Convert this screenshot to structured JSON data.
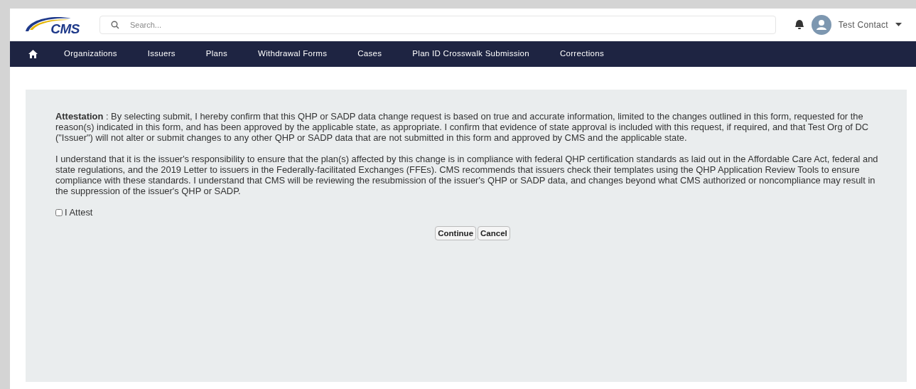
{
  "header": {
    "logo": "CMS",
    "search": {
      "placeholder": "Search..."
    },
    "user": "Test Contact"
  },
  "nav": {
    "items": [
      {
        "label": "Organizations"
      },
      {
        "label": "Issuers"
      },
      {
        "label": "Plans"
      },
      {
        "label": "Withdrawal Forms"
      },
      {
        "label": "Cases"
      },
      {
        "label": "Plan ID Crosswalk Submission"
      },
      {
        "label": "Corrections"
      }
    ]
  },
  "attestation": {
    "paragraphs": [
      "**Attestation** : By selecting submit, I hereby confirm that this QHP or SADP data change request is based on true and accurate information, limited to the changes outlined in this form, requested for the reason(s) indicated in this form, and has been approved by the applicable state, as appropriate. I confirm that evidence of state approval is included with this request, if required, and that Test Org of DC (\"Issuer\") will not alter or submit changes to any other QHP or SADP data that are not submitted in this form and approved by CMS and the applicable state.",
      "I understand that it is the issuer's responsibility to ensure that the plan(s) affected by this change is in compliance with federal QHP certification standards as laid out in the Affordable Care Act, federal and state regulations, and the 2019 Letter to issuers in the Federally-facilitated Exchanges (FFEs). CMS recommends that issuers check their templates using the QHP Application Review Tools to ensure compliance with these standards. I understand that CMS will be reviewing the resubmission of the issuer's QHP or SADP data, and changes beyond what CMS authorized or noncompliance may result in the suppression of the issuer's QHP or SADP."
    ],
    "checkbox": {
      "label": "I Attest",
      "checked": false
    },
    "buttons": [
      "Continue",
      "Cancel"
    ]
  }
}
